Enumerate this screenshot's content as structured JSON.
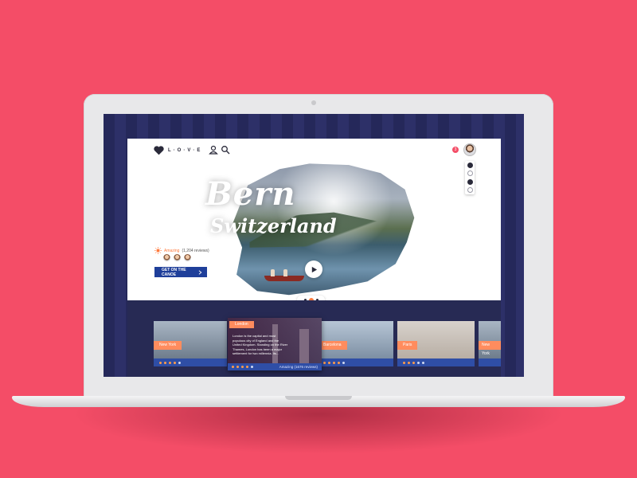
{
  "colors": {
    "background": "#f44d67",
    "accent_orange": "#ff8c5e",
    "primary_blue": "#1f3f9a",
    "navy": "#272a54"
  },
  "header": {
    "logo_icon": "heart-icon",
    "logo_text": "L·O·V·E",
    "icons": [
      "user-icon",
      "search-icon"
    ],
    "notification_count": "3"
  },
  "side_rail": {
    "items": [
      "grid-icon",
      "globe-icon",
      "avatar-icon",
      "circle-icon"
    ]
  },
  "hero": {
    "title": "Bern",
    "subtitle": "Switzerland",
    "rating_label": "Amazing",
    "rating_count": "(1,204 reviews)",
    "cta_label": "GET ON THE CANOE",
    "cta_icon": "chevron-right-icon",
    "pager_active_index": 1
  },
  "cities": [
    {
      "name": "New York",
      "stars": 4,
      "color": "#8a9aa8"
    },
    {
      "name": "Barcelona",
      "stars": 4,
      "color": "#9fb0c0"
    },
    {
      "name": "Paris",
      "stars": 4,
      "color": "#c8c2bc"
    },
    {
      "name": "New York",
      "stars": 4,
      "color": "#8a9aa8"
    }
  ],
  "featured": {
    "name": "London",
    "description": "London is the capital and most populous city of England and the United Kingdom. Standing on the River Thames, London has been a major settlement for two millennia. Its...",
    "stars": 4,
    "rating_label": "Amazing",
    "rating_count": "(1676 reviews)"
  }
}
